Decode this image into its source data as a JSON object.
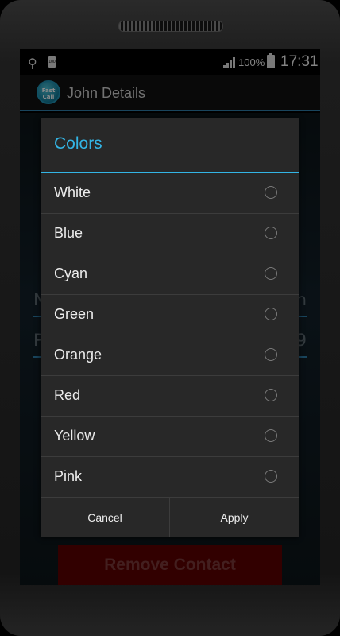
{
  "status_bar": {
    "small_battery_text": "100",
    "battery_percent": "100%",
    "time": "17:31"
  },
  "action_bar": {
    "logo_text": "Fast Call",
    "title": "John Details"
  },
  "background_form": {
    "name_field_start": "N",
    "name_field_end": "n",
    "phone_field_start": "P",
    "phone_field_end": "9",
    "remove_button": "Remove Contact"
  },
  "dialog": {
    "title": "Colors",
    "options": [
      "White",
      "Blue",
      "Cyan",
      "Green",
      "Orange",
      "Red",
      "Yellow",
      "Pink"
    ],
    "cancel_label": "Cancel",
    "apply_label": "Apply"
  },
  "colors": {
    "accent": "#33b5e5",
    "action_bar_line": "#2e7eaa",
    "remove_button_bg": "#5b0000"
  }
}
